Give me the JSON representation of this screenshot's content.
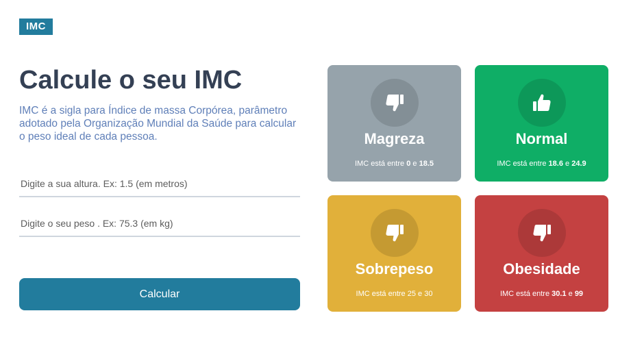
{
  "logo": {
    "text": "IMC"
  },
  "heading": {
    "title": "Calcule o seu IMC",
    "description": "IMC é a sigla para Índice de massa Corpórea, parâmetro adotado pela Organização Mundial da Saúde para calcular o peso ideal de cada pessoa."
  },
  "form": {
    "height_placeholder": "Digite a sua altura. Ex: 1.5 (em metros)",
    "weight_placeholder": "Digite o seu peso . Ex: 75.3 (em kg)",
    "submit_label": "Calcular"
  },
  "categories": [
    {
      "title": "Magreza",
      "range_prefix": "IMC está entre",
      "min": "0",
      "connector": "e",
      "max": "18.5",
      "icon": "thumbs-down-icon",
      "color": "#96a3ab"
    },
    {
      "title": "Normal",
      "range_prefix": "IMC está entre",
      "min": "18.6",
      "connector": "e",
      "max": "24.9",
      "icon": "thumbs-up-icon",
      "color": "#0fae66"
    },
    {
      "title": "Sobrepeso",
      "range_prefix": "IMC está entre",
      "min": "25",
      "connector": "e",
      "max": "30",
      "icon": "thumbs-down-icon",
      "color": "#e1b03a"
    },
    {
      "title": "Obesidade",
      "range_prefix": "IMC está entre",
      "min": "30.1",
      "connector": "e",
      "max": "99",
      "icon": "thumbs-down-icon",
      "color": "#c44141"
    }
  ]
}
